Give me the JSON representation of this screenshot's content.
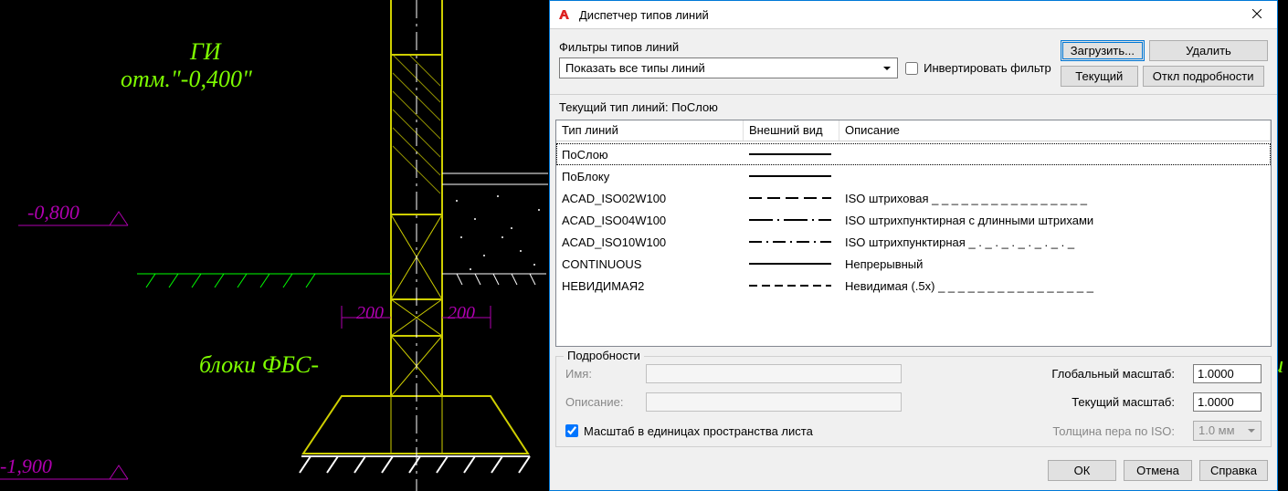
{
  "cad_background": {
    "text_gi": "ГИ",
    "text_elev": "отм.\"-0,400\"",
    "text_neg_0800": "-0,800",
    "text_200_left": "200",
    "text_200_right": "200",
    "text_fbs": "блоки ФБС-",
    "text_neg_1900": "-1,900",
    "text_right_frag": "ки"
  },
  "dialog": {
    "title": "Диспетчер типов линий",
    "filters_label": "Фильтры типов линий",
    "filter_combo_value": "Показать все типы линий",
    "invert_filter_label": "Инвертировать фильтр",
    "btn_load": "Загрузить...",
    "btn_delete": "Удалить",
    "btn_current": "Текущий",
    "btn_hide_details": "Откл подробности",
    "current_ltype_label": "Текущий тип линий:  ПоСлою",
    "columns": {
      "name": "Тип линий",
      "appearance": "Внешний вид",
      "description": "Описание"
    },
    "rows": [
      {
        "name": "ПоСлою",
        "pattern": "solid",
        "desc": ""
      },
      {
        "name": "ПоБлоку",
        "pattern": "solid",
        "desc": ""
      },
      {
        "name": "ACAD_ISO02W100",
        "pattern": "dash",
        "desc": "ISO штриховая _ _ _ _ _ _ _ _ _ _ _ _ _ _ _ _"
      },
      {
        "name": "ACAD_ISO04W100",
        "pattern": "long-dot",
        "desc": "ISO штрихпунктирная с длинными штрихами"
      },
      {
        "name": "ACAD_ISO10W100",
        "pattern": "dash-dot",
        "desc": "ISO штрихпунктирная _ . _ . _ . _ . _ . _ . _"
      },
      {
        "name": "CONTINUOUS",
        "pattern": "solid",
        "desc": "Непрерывный"
      },
      {
        "name": "НЕВИДИМАЯ2",
        "pattern": "short-dash",
        "desc": "Невидимая (.5x) _ _ _ _ _ _ _ _ _ _ _ _ _ _ _ _"
      }
    ],
    "selected_row_index": 0,
    "details": {
      "legend": "Подробности",
      "name_label": "Имя:",
      "name_value": "",
      "desc_label": "Описание:",
      "desc_value": "",
      "paper_units_label": "Масштаб в единицах пространства листа",
      "paper_units_checked": true,
      "global_scale_label": "Глобальный масштаб:",
      "global_scale_value": "1.0000",
      "current_scale_label": "Текущий масштаб:",
      "current_scale_value": "1.0000",
      "iso_pen_label": "Толщина пера по ISO:",
      "iso_pen_value": "1.0 мм"
    },
    "btn_ok": "ОК",
    "btn_cancel": "Отмена",
    "btn_help": "Справка"
  }
}
